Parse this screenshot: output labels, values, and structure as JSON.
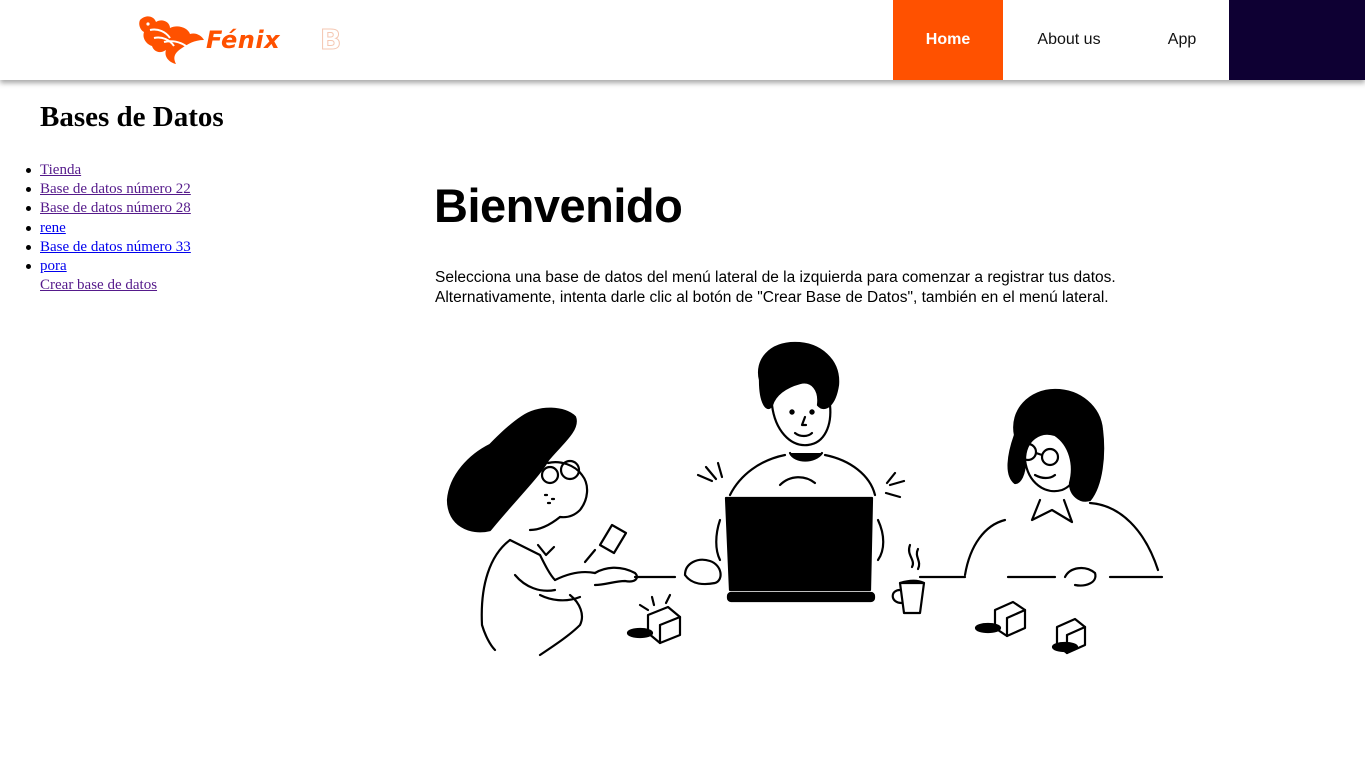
{
  "header": {
    "logo": {
      "text": "Fénix",
      "suffix": "B",
      "brand_color": "#ff5100",
      "icon": "phoenix-bird-icon"
    },
    "nav": [
      {
        "label": "Home",
        "active": true
      },
      {
        "label": "About us",
        "active": false
      },
      {
        "label": "App",
        "active": false
      }
    ],
    "nav_active_color": "#ff5100",
    "dark_block_color": "#0e0033"
  },
  "sidebar": {
    "title": "Bases de Datos",
    "items": [
      {
        "label": "Tienda"
      },
      {
        "label": "Base de datos número 22"
      },
      {
        "label": "Base de datos número 28"
      },
      {
        "label": "rene"
      },
      {
        "label": "Base de datos número 33"
      },
      {
        "label": "pora"
      }
    ],
    "create_link": "Crear base de datos"
  },
  "main": {
    "title": "Bienvenido",
    "text": "Selecciona una base de datos del menú lateral de la izquierda para comenzar a registrar tus datos. Alternativamente, intenta darle clic al botón de \"Crear Base de Datos\", también en el menú lateral.",
    "illustration_icon": "team-working-illustration"
  }
}
